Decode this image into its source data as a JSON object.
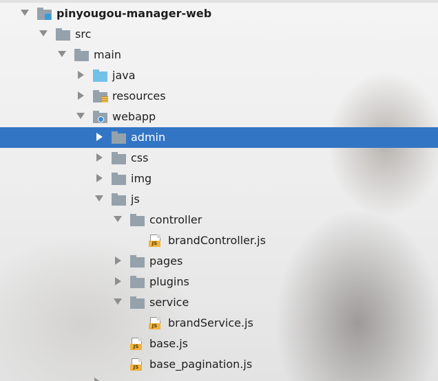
{
  "project_tree": {
    "items": [
      {
        "label": "pinyougou-manager-web",
        "kind": "module",
        "expanded": true,
        "bold": true,
        "depth": 0
      },
      {
        "label": "src",
        "kind": "folder",
        "expanded": true,
        "depth": 1
      },
      {
        "label": "main",
        "kind": "folder",
        "expanded": true,
        "depth": 2
      },
      {
        "label": "java",
        "kind": "source-folder",
        "expanded": false,
        "depth": 3
      },
      {
        "label": "resources",
        "kind": "resources-folder",
        "expanded": false,
        "depth": 3
      },
      {
        "label": "webapp",
        "kind": "web-folder",
        "expanded": true,
        "depth": 3
      },
      {
        "label": "admin",
        "kind": "folder",
        "expanded": false,
        "depth": 4,
        "selected": true
      },
      {
        "label": "css",
        "kind": "folder",
        "expanded": false,
        "depth": 4
      },
      {
        "label": "img",
        "kind": "folder",
        "expanded": false,
        "depth": 4
      },
      {
        "label": "js",
        "kind": "folder",
        "expanded": true,
        "depth": 4
      },
      {
        "label": "controller",
        "kind": "folder",
        "expanded": true,
        "depth": 5
      },
      {
        "label": "brandController.js",
        "kind": "js-file",
        "depth": 6
      },
      {
        "label": "pages",
        "kind": "folder",
        "expanded": false,
        "depth": 5
      },
      {
        "label": "plugins",
        "kind": "folder",
        "expanded": false,
        "depth": 5
      },
      {
        "label": "service",
        "kind": "folder",
        "expanded": true,
        "depth": 5
      },
      {
        "label": "brandService.js",
        "kind": "js-file",
        "depth": 6
      },
      {
        "label": "base.js",
        "kind": "js-file",
        "depth": 5
      },
      {
        "label": "base_pagination.js",
        "kind": "js-file",
        "depth": 5
      }
    ]
  },
  "icons": {
    "folder": "folder-icon",
    "source-folder": "source-folder-icon",
    "resources-folder": "resources-folder-icon",
    "web-folder": "web-folder-icon",
    "module": "module-icon",
    "js-file": "javascript-file-icon",
    "js_badge_text": "JS"
  },
  "colors": {
    "selection": "#3275c5",
    "folder": "#95a2ac",
    "source_folder": "#71c1e8",
    "js_badge": "#f0b33d"
  }
}
